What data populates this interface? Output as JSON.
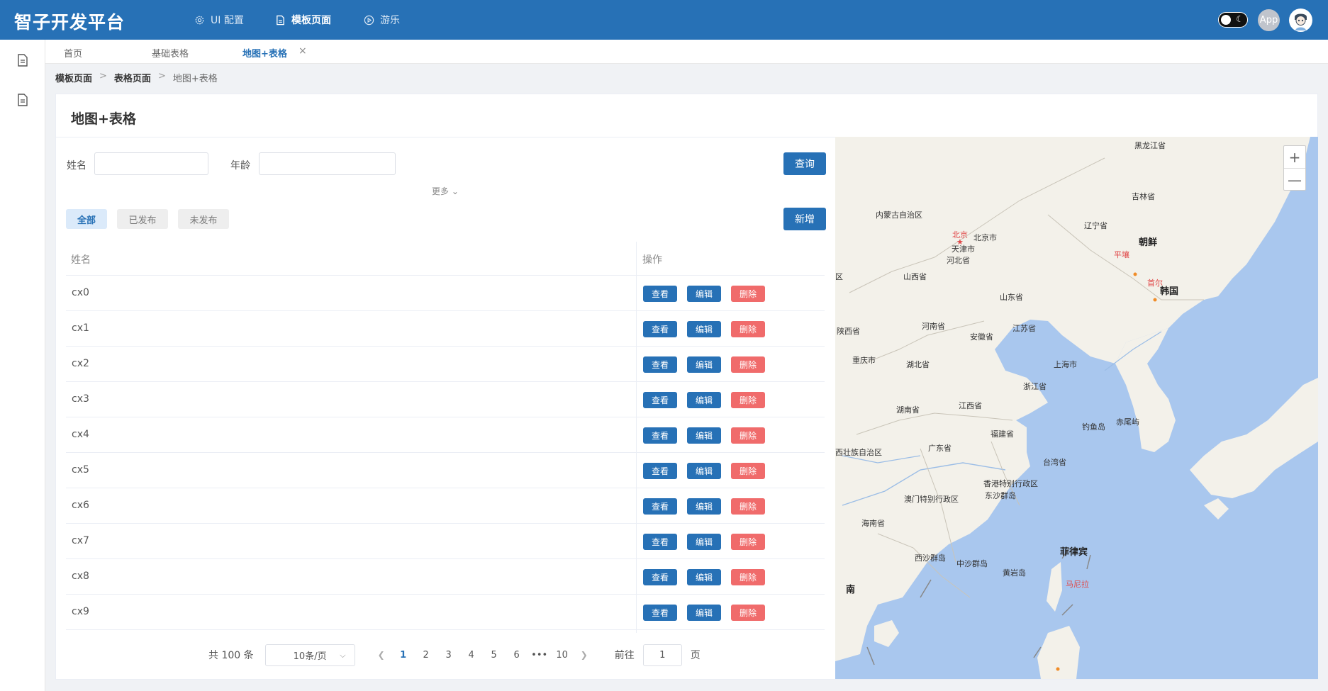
{
  "app": {
    "title": "智子开发平台"
  },
  "topnav": [
    {
      "label": "UI 配置",
      "icon": "gear-icon"
    },
    {
      "label": "模板页面",
      "icon": "document-icon"
    },
    {
      "label": "游乐",
      "icon": "play-circle-icon"
    }
  ],
  "header_right": {
    "app_badge": "App"
  },
  "tabs": [
    {
      "label": "首页"
    },
    {
      "label": "基础表格"
    },
    {
      "label": "地图+表格"
    }
  ],
  "tab_close": "×",
  "breadcrumb": [
    "模板页面",
    ">",
    "表格页面",
    ">",
    "地图+表格"
  ],
  "card": {
    "title": "地图+表格"
  },
  "search": {
    "name_label": "姓名",
    "age_label": "年龄",
    "name_value": "",
    "age_value": "",
    "query_button": "查询",
    "more": "更多 ⌄"
  },
  "filters": [
    "全部",
    "已发布",
    "未发布"
  ],
  "add_button": "新增",
  "table": {
    "columns": [
      "姓名",
      "操作"
    ],
    "rows": [
      "cx0",
      "cx1",
      "cx2",
      "cx3",
      "cx4",
      "cx5",
      "cx6",
      "cx7",
      "cx8",
      "cx9"
    ],
    "actions": {
      "view": "查看",
      "edit": "编辑",
      "delete": "删除"
    }
  },
  "pagination": {
    "total": "共 100 条",
    "page_size": "10条/页",
    "pages": [
      "1",
      "2",
      "3",
      "4",
      "5",
      "6",
      "•••",
      "10"
    ],
    "current": "1",
    "goto_label": "前往",
    "goto_value": "1",
    "page_unit": "页"
  },
  "map": {
    "zoom_in": "+",
    "zoom_out": "—",
    "labels": [
      {
        "id": "heilongjiang",
        "text": "黑龙江省"
      },
      {
        "id": "jilin",
        "text": "吉林省"
      },
      {
        "id": "neimenggu",
        "text": "内蒙古自治区"
      },
      {
        "id": "liaoning",
        "text": "辽宁省"
      },
      {
        "id": "beijing",
        "text": "北京"
      },
      {
        "id": "beijingshi",
        "text": "北京市"
      },
      {
        "id": "tianjin",
        "text": "天津市"
      },
      {
        "id": "chaoxian",
        "text": "朝鲜"
      },
      {
        "id": "pyongyang",
        "text": "平壤"
      },
      {
        "id": "hebei",
        "text": "河北省"
      },
      {
        "id": "shanxi",
        "text": "山西省"
      },
      {
        "id": "seoul",
        "text": "首尔"
      },
      {
        "id": "hanguo",
        "text": "韩国"
      },
      {
        "id": "shandong",
        "text": "山东省"
      },
      {
        "id": "qu",
        "text": "区"
      },
      {
        "id": "shaanxi",
        "text": "陕西省"
      },
      {
        "id": "henan",
        "text": "河南省"
      },
      {
        "id": "jiangsu",
        "text": "江苏省"
      },
      {
        "id": "anhui",
        "text": "安徽省"
      },
      {
        "id": "chongqing",
        "text": "重庆市"
      },
      {
        "id": "hubei",
        "text": "湖北省"
      },
      {
        "id": "shanghai",
        "text": "上海市"
      },
      {
        "id": "zhejiang",
        "text": "浙江省"
      },
      {
        "id": "hunan",
        "text": "湖南省"
      },
      {
        "id": "jiangxi",
        "text": "江西省"
      },
      {
        "id": "diaoyu",
        "text": "钓鱼岛"
      },
      {
        "id": "chiwei",
        "text": "赤尾屿"
      },
      {
        "id": "fujian",
        "text": "福建省"
      },
      {
        "id": "guangxi",
        "text": "西壮族自治区"
      },
      {
        "id": "guangdong",
        "text": "广东省"
      },
      {
        "id": "taiwan",
        "text": "台湾省"
      },
      {
        "id": "hongkong",
        "text": "香港特别行政区"
      },
      {
        "id": "macau",
        "text": "澳门特别行政区"
      },
      {
        "id": "dongsha",
        "text": "东沙群岛"
      },
      {
        "id": "hainan",
        "text": "海南省"
      },
      {
        "id": "feilvbin",
        "text": "菲律宾"
      },
      {
        "id": "xisha",
        "text": "西沙群岛"
      },
      {
        "id": "zhongsha",
        "text": "中沙群岛"
      },
      {
        "id": "huangyan",
        "text": "黄岩岛"
      },
      {
        "id": "nan",
        "text": "南"
      },
      {
        "id": "manila",
        "text": "马尼拉"
      }
    ]
  },
  "colors": {
    "primary": "#2771b6",
    "danger": "#f06b6b",
    "sea": "#a9c7ee",
    "land": "#f3f1ea"
  }
}
